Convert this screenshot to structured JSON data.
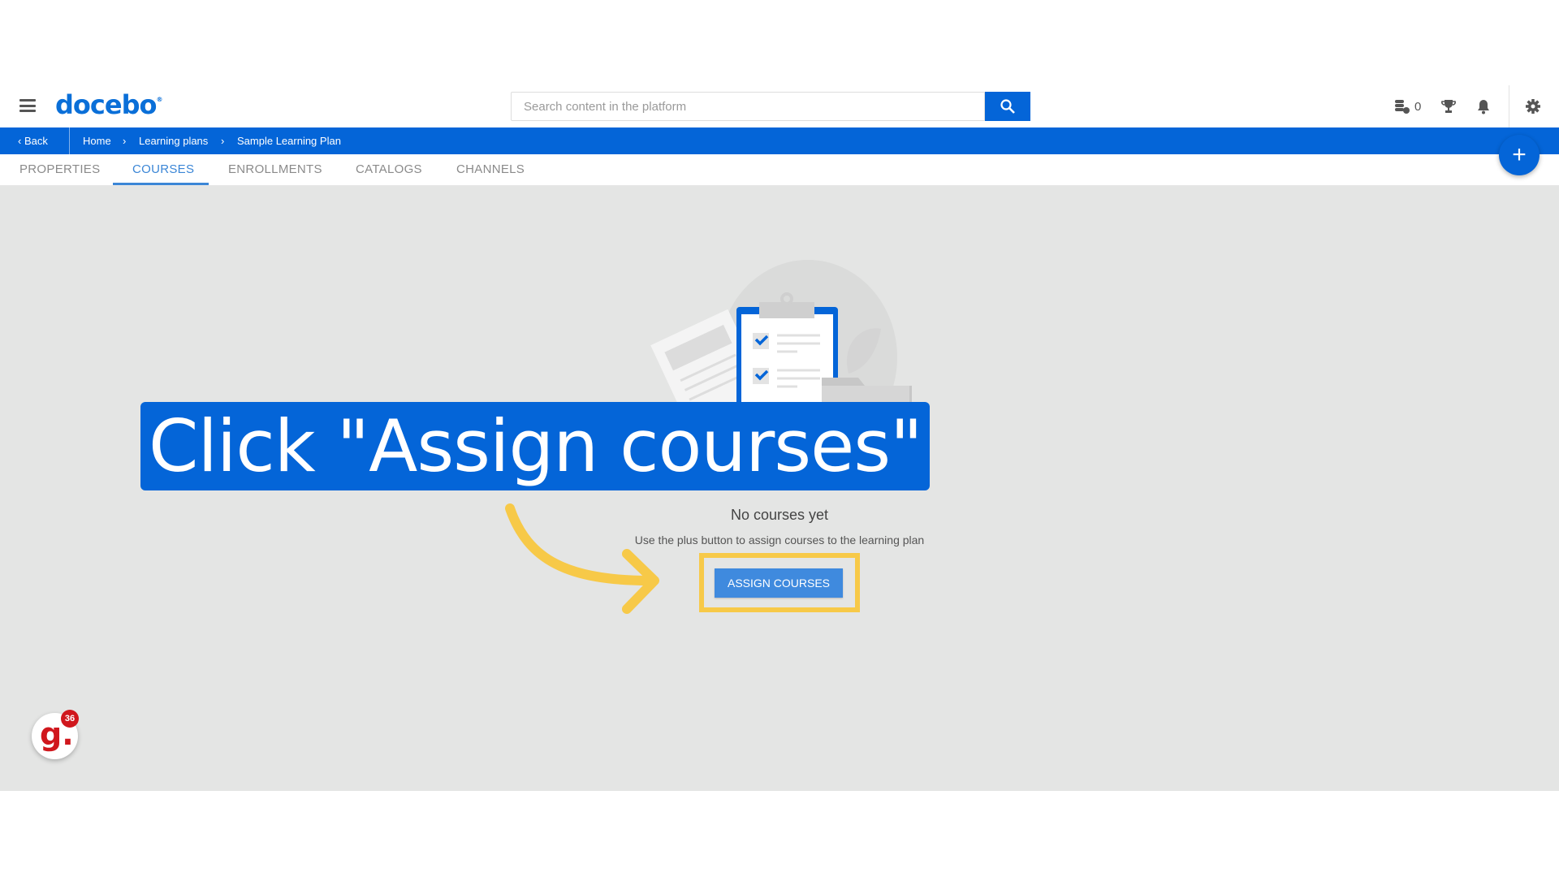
{
  "header": {
    "logo": "docebo",
    "search_placeholder": "Search content in the platform",
    "credits_count": "0"
  },
  "breadcrumb": {
    "back": "Back",
    "items": [
      "Home",
      "Learning plans",
      "Sample Learning Plan"
    ]
  },
  "tabs": [
    {
      "label": "PROPERTIES"
    },
    {
      "label": "COURSES",
      "active": true
    },
    {
      "label": "ENROLLMENTS"
    },
    {
      "label": "CATALOGS"
    },
    {
      "label": "CHANNELS"
    }
  ],
  "empty_state": {
    "title": "No courses yet",
    "subtitle": "Use the plus button to assign courses to the learning plan",
    "button": "ASSIGN COURSES"
  },
  "callout": {
    "text": "Click \"Assign courses\""
  },
  "fab": {
    "label": "+"
  },
  "gamification": {
    "letter": "g.",
    "count": "36"
  },
  "colors": {
    "brand": "#0465d8",
    "highlight": "#f7c948",
    "background": "#e4e5e4"
  }
}
